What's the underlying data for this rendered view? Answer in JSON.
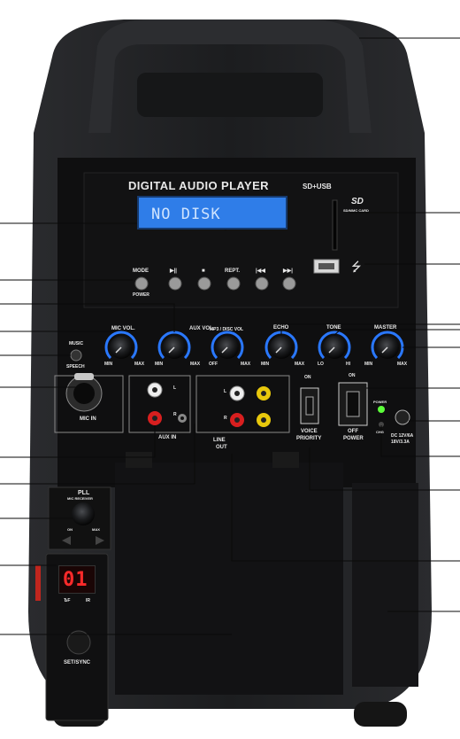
{
  "header": {
    "title": "DIGITAL AUDIO PLAYER",
    "subtitle": "SD+USB"
  },
  "display": {
    "text": "NO DISK"
  },
  "sd_logo": {
    "text": "SD",
    "caption": "SD/MMC CARD"
  },
  "transport": {
    "mode_label": "MODE",
    "power_label": "POWER",
    "play_pause": "▶||",
    "stop": "■",
    "repeat": "REPT.",
    "prev": "|◀◀",
    "next": "▶▶|"
  },
  "knobs": {
    "mic_vol": {
      "label": "MIC VOL.",
      "min": "MIN",
      "max": "MAX"
    },
    "aux_vol": {
      "label": "AUX VOL.",
      "min": "MIN",
      "max": "MAX"
    },
    "mp3_vol": {
      "label": "MP3 / DISC VOL",
      "min": "OFF",
      "max": "MAX"
    },
    "echo": {
      "label": "ECHO",
      "min": "MIN",
      "max": "MAX"
    },
    "tone": {
      "label": "TONE",
      "min": "LO",
      "max": "HI"
    },
    "master": {
      "label": "MASTER",
      "min": "MIN",
      "max": "MAX"
    }
  },
  "mode_switch": {
    "music": "MUSIC",
    "speech": "SPEECH"
  },
  "inputs": {
    "mic_in": "MIC IN",
    "aux_in": "AUX IN",
    "line_out_1": "LINE",
    "line_out_2": "OUT",
    "left": "L",
    "right": "R"
  },
  "voice_priority": {
    "on": "ON",
    "label_1": "VOICE",
    "label_2": "PRIORITY"
  },
  "power_switch": {
    "on": "ON",
    "off": "OFF",
    "label": "POWER"
  },
  "power_indicator": {
    "power": "POWER",
    "chg": "CHG"
  },
  "dc_input": {
    "line_1": "DC 12V/6A",
    "line_2": "18V/3.3A"
  },
  "receiver": {
    "title": "PLL",
    "subtitle": "MIC RECEIVER",
    "on": "ON",
    "max": "MAX"
  },
  "channel": {
    "digits": "01",
    "down": "ѢF",
    "up": "IR"
  },
  "set_sync": "SET/SYNC",
  "colors": {
    "body": "#1d1e20",
    "panel": "#0f0f10",
    "lcd": "#2f7de8",
    "knob_arc": "#2a78ff",
    "rca_red": "#d81f1f",
    "rca_yellow": "#e8c80c",
    "led_green": "#5cff3a",
    "led_red": "#ff2a2a",
    "callout": "#0a0a0a"
  }
}
